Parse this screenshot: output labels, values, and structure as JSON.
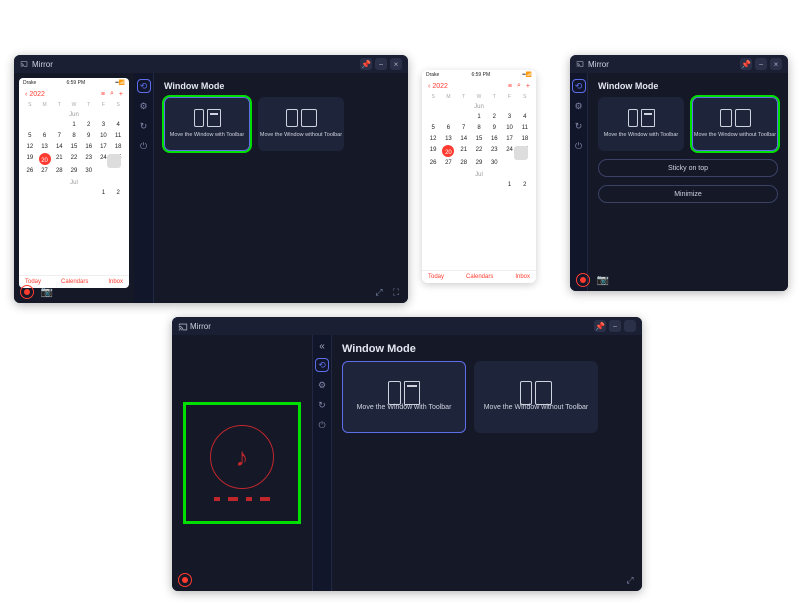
{
  "app": {
    "title": "Mirror"
  },
  "titlebar": {
    "pin": "📌",
    "min": "−",
    "close": "×"
  },
  "section": {
    "window_mode": "Window Mode"
  },
  "modes": {
    "with_toolbar": "Move the Window\nwith Toolbar",
    "without_toolbar": "Move the Window\nwithout Toolbar"
  },
  "buttons": {
    "sticky": "Sticky on top",
    "minimize": "Minimize"
  },
  "phone": {
    "status_left": "Drake",
    "status_time": "6:59 PM",
    "back_year": "2022",
    "month1": "Jun",
    "month2": "Jul",
    "today": "Today",
    "calendars": "Calendars",
    "inbox": "Inbox"
  },
  "calendar": {
    "dow": [
      "S",
      "M",
      "T",
      "W",
      "T",
      "F",
      "S"
    ],
    "jun_leading_blanks": 3,
    "jun_days": 30,
    "jun_today": 20,
    "jul_shown": [
      1,
      2
    ]
  }
}
